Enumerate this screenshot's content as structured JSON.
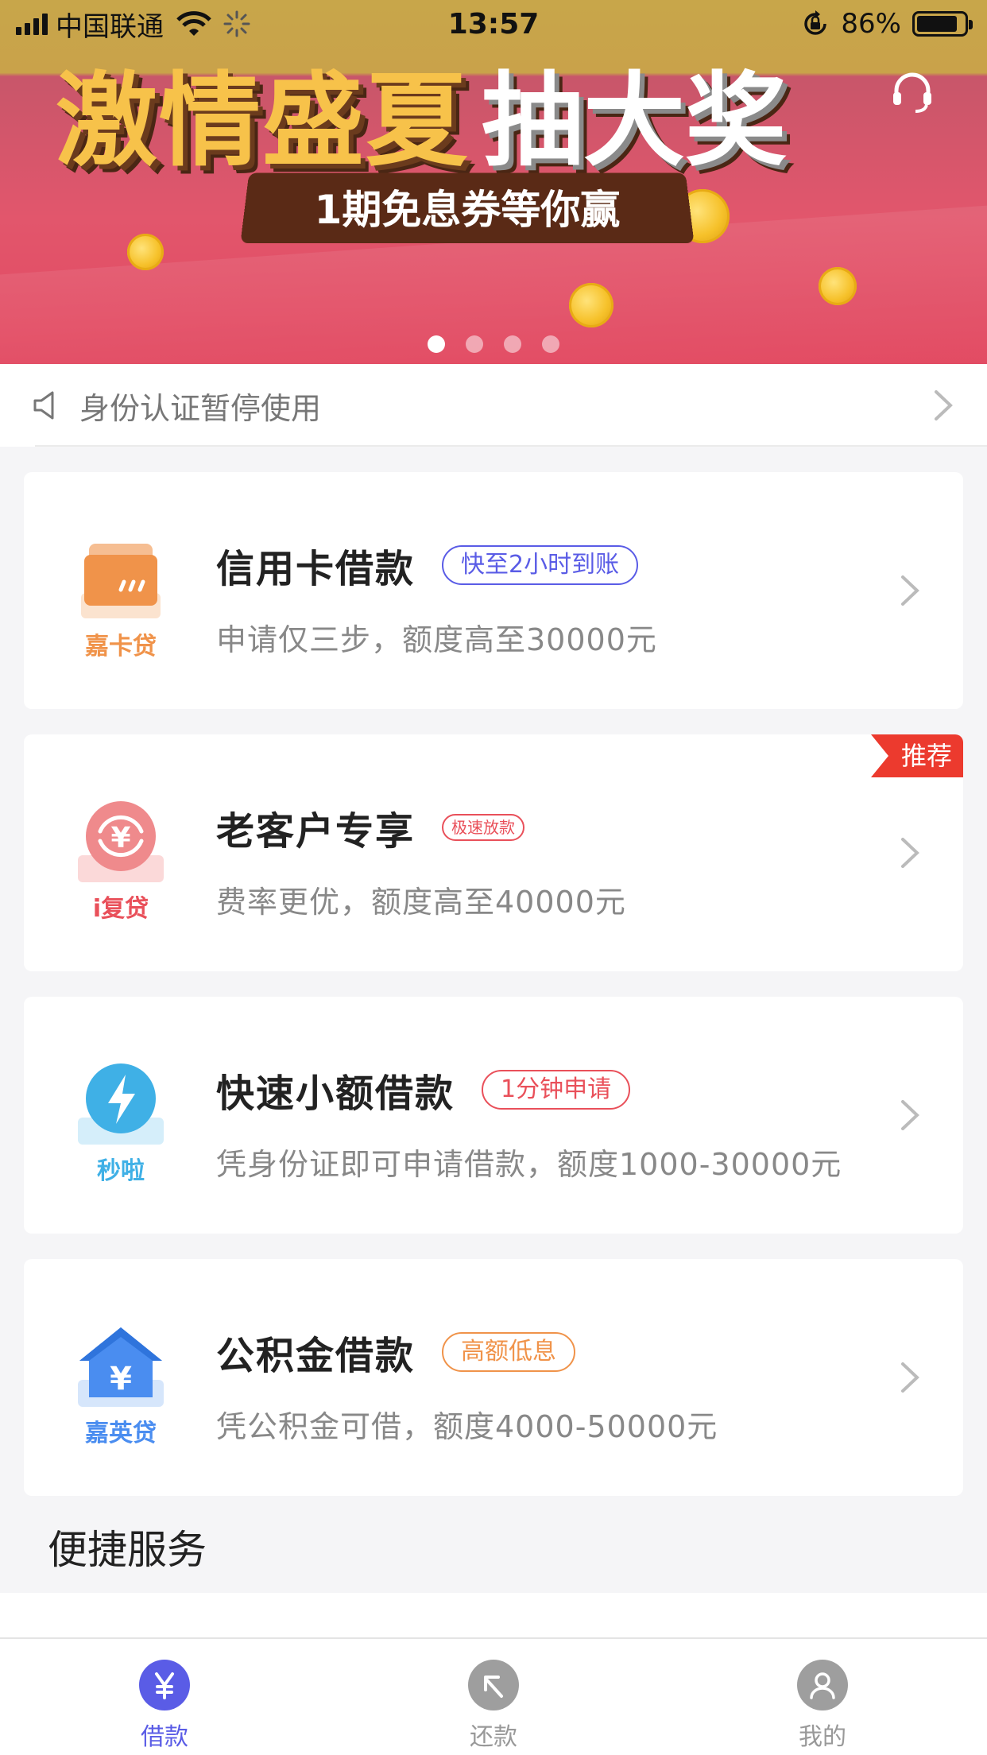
{
  "status_bar": {
    "carrier": "中国联通",
    "time": "13:57",
    "battery": "86%",
    "battery_level": 0.86
  },
  "banner": {
    "title_part1": "激情盛夏",
    "title_part2": "抽大奖",
    "subtitle": "1期免息券等你赢",
    "page_count": 4,
    "active_page": 1
  },
  "notice": {
    "text": "身份认证暂停使用"
  },
  "cards": [
    {
      "logo_label": "嘉卡贷",
      "title": "信用卡借款",
      "tag": "快至2小时到账",
      "desc": "申请仅三步，额度高至30000元",
      "accent": "#f0934a",
      "tag_color": "#5a5ce6"
    },
    {
      "logo_label": "i复贷",
      "title": "老客户专享",
      "tag": "极速放款",
      "desc": "费率更优，额度高至40000元",
      "accent": "#e9505a",
      "tag_color": "#e9505a",
      "badge": "推荐"
    },
    {
      "logo_label": "秒啦",
      "title": "快速小额借款",
      "tag": "1分钟申请",
      "desc": "凭身份证即可申请借款，额度1000-30000元",
      "accent": "#3fb0e6",
      "tag_color": "#e9505a"
    },
    {
      "logo_label": "嘉英贷",
      "title": "公积金借款",
      "tag": "高额低息",
      "desc": "凭公积金可借，额度4000-50000元",
      "accent": "#4a8df0",
      "tag_color": "#f0934a"
    }
  ],
  "section": {
    "title": "便捷服务"
  },
  "tabbar": {
    "items": [
      {
        "label": "借款",
        "icon": "yuan-icon",
        "active": true
      },
      {
        "label": "还款",
        "icon": "return-arrow-icon",
        "active": false
      },
      {
        "label": "我的",
        "icon": "person-icon",
        "active": false
      }
    ],
    "active_color": "#5a5ce6",
    "inactive_color": "#999999"
  }
}
